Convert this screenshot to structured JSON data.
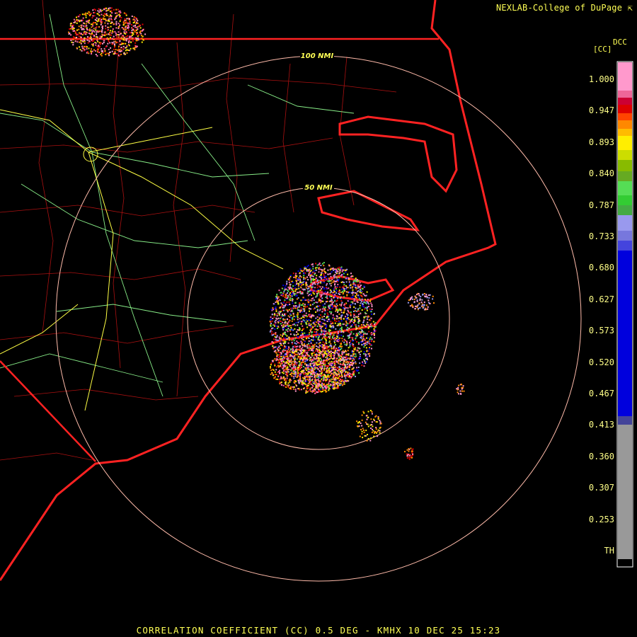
{
  "header": {
    "credit": "NEXLAB-College of DuPage",
    "product_code": "DCC",
    "unit": "[CC]"
  },
  "range_rings": [
    {
      "label": "100 NMI",
      "radius_nmi": 100
    },
    {
      "label": "50 NMI",
      "radius_nmi": 50
    }
  ],
  "colorbar": {
    "labels": [
      "1.000",
      "0.947",
      "0.893",
      "0.840",
      "0.787",
      "0.733",
      "0.680",
      "0.627",
      "0.573",
      "0.520",
      "0.467",
      "0.413",
      "0.360",
      "0.307",
      "0.253",
      "TH"
    ],
    "colors": {
      "pink": "#ff99cc",
      "red": "#dd0000",
      "orange": "#ff8800",
      "yellow": "#ffee00",
      "green": "#55dd55",
      "lavender": "#9999ee",
      "blue": "#0000dd",
      "gray": "#999999"
    }
  },
  "map_colors": {
    "coast_and_state": "#ff2222",
    "county": "#bb1111",
    "highway": "#ffff44",
    "road": "#88ee88",
    "ring": "#ffbbaa"
  },
  "caption": "CORRELATION COEFFICIENT (CC) 0.5 DEG - KMHX 10 DEC 25 15:23"
}
